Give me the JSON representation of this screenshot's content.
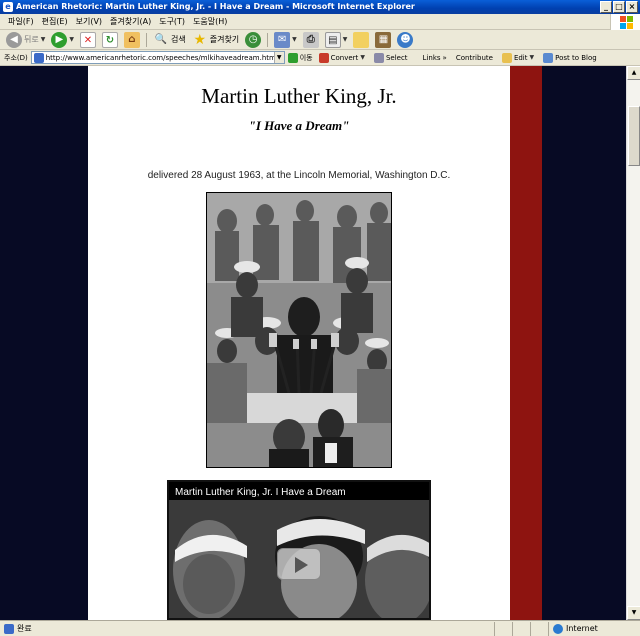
{
  "window": {
    "title": "American Rhetoric: Martin Luther King, Jr. - I Have a Dream - Microsoft Internet Explorer"
  },
  "menu": [
    "파일(F)",
    "편집(E)",
    "보기(V)",
    "즐겨찾기(A)",
    "도구(T)",
    "도움말(H)"
  ],
  "toolbar": {
    "back_label": "뒤로",
    "search_label": "검색",
    "favorites_label": "즐겨찾기"
  },
  "addressbar": {
    "label": "주소(D)",
    "url": "http://www.americanrhetoric.com/speeches/mlkihaveadream.htm",
    "go_label": "이동",
    "convert_label": "Convert",
    "select_label": "Select",
    "links_label": "Links",
    "contribute_label": "Contribute",
    "edit_label": "Edit",
    "post_label": "Post to Blog"
  },
  "page": {
    "title": "Martin Luther King, Jr.",
    "subtitle": "\"I Have a Dream\"",
    "delivered": "delivered 28 August 1963, at the Lincoln Memorial, Washington D.C."
  },
  "video": {
    "title": "Martin Luther King, Jr. I Have a Dream"
  },
  "status": {
    "left": "완료",
    "zone": "Internet"
  },
  "colors": {
    "navy": "#070a24",
    "red": "#8e1410",
    "titlebar": "#0a5fd8"
  }
}
